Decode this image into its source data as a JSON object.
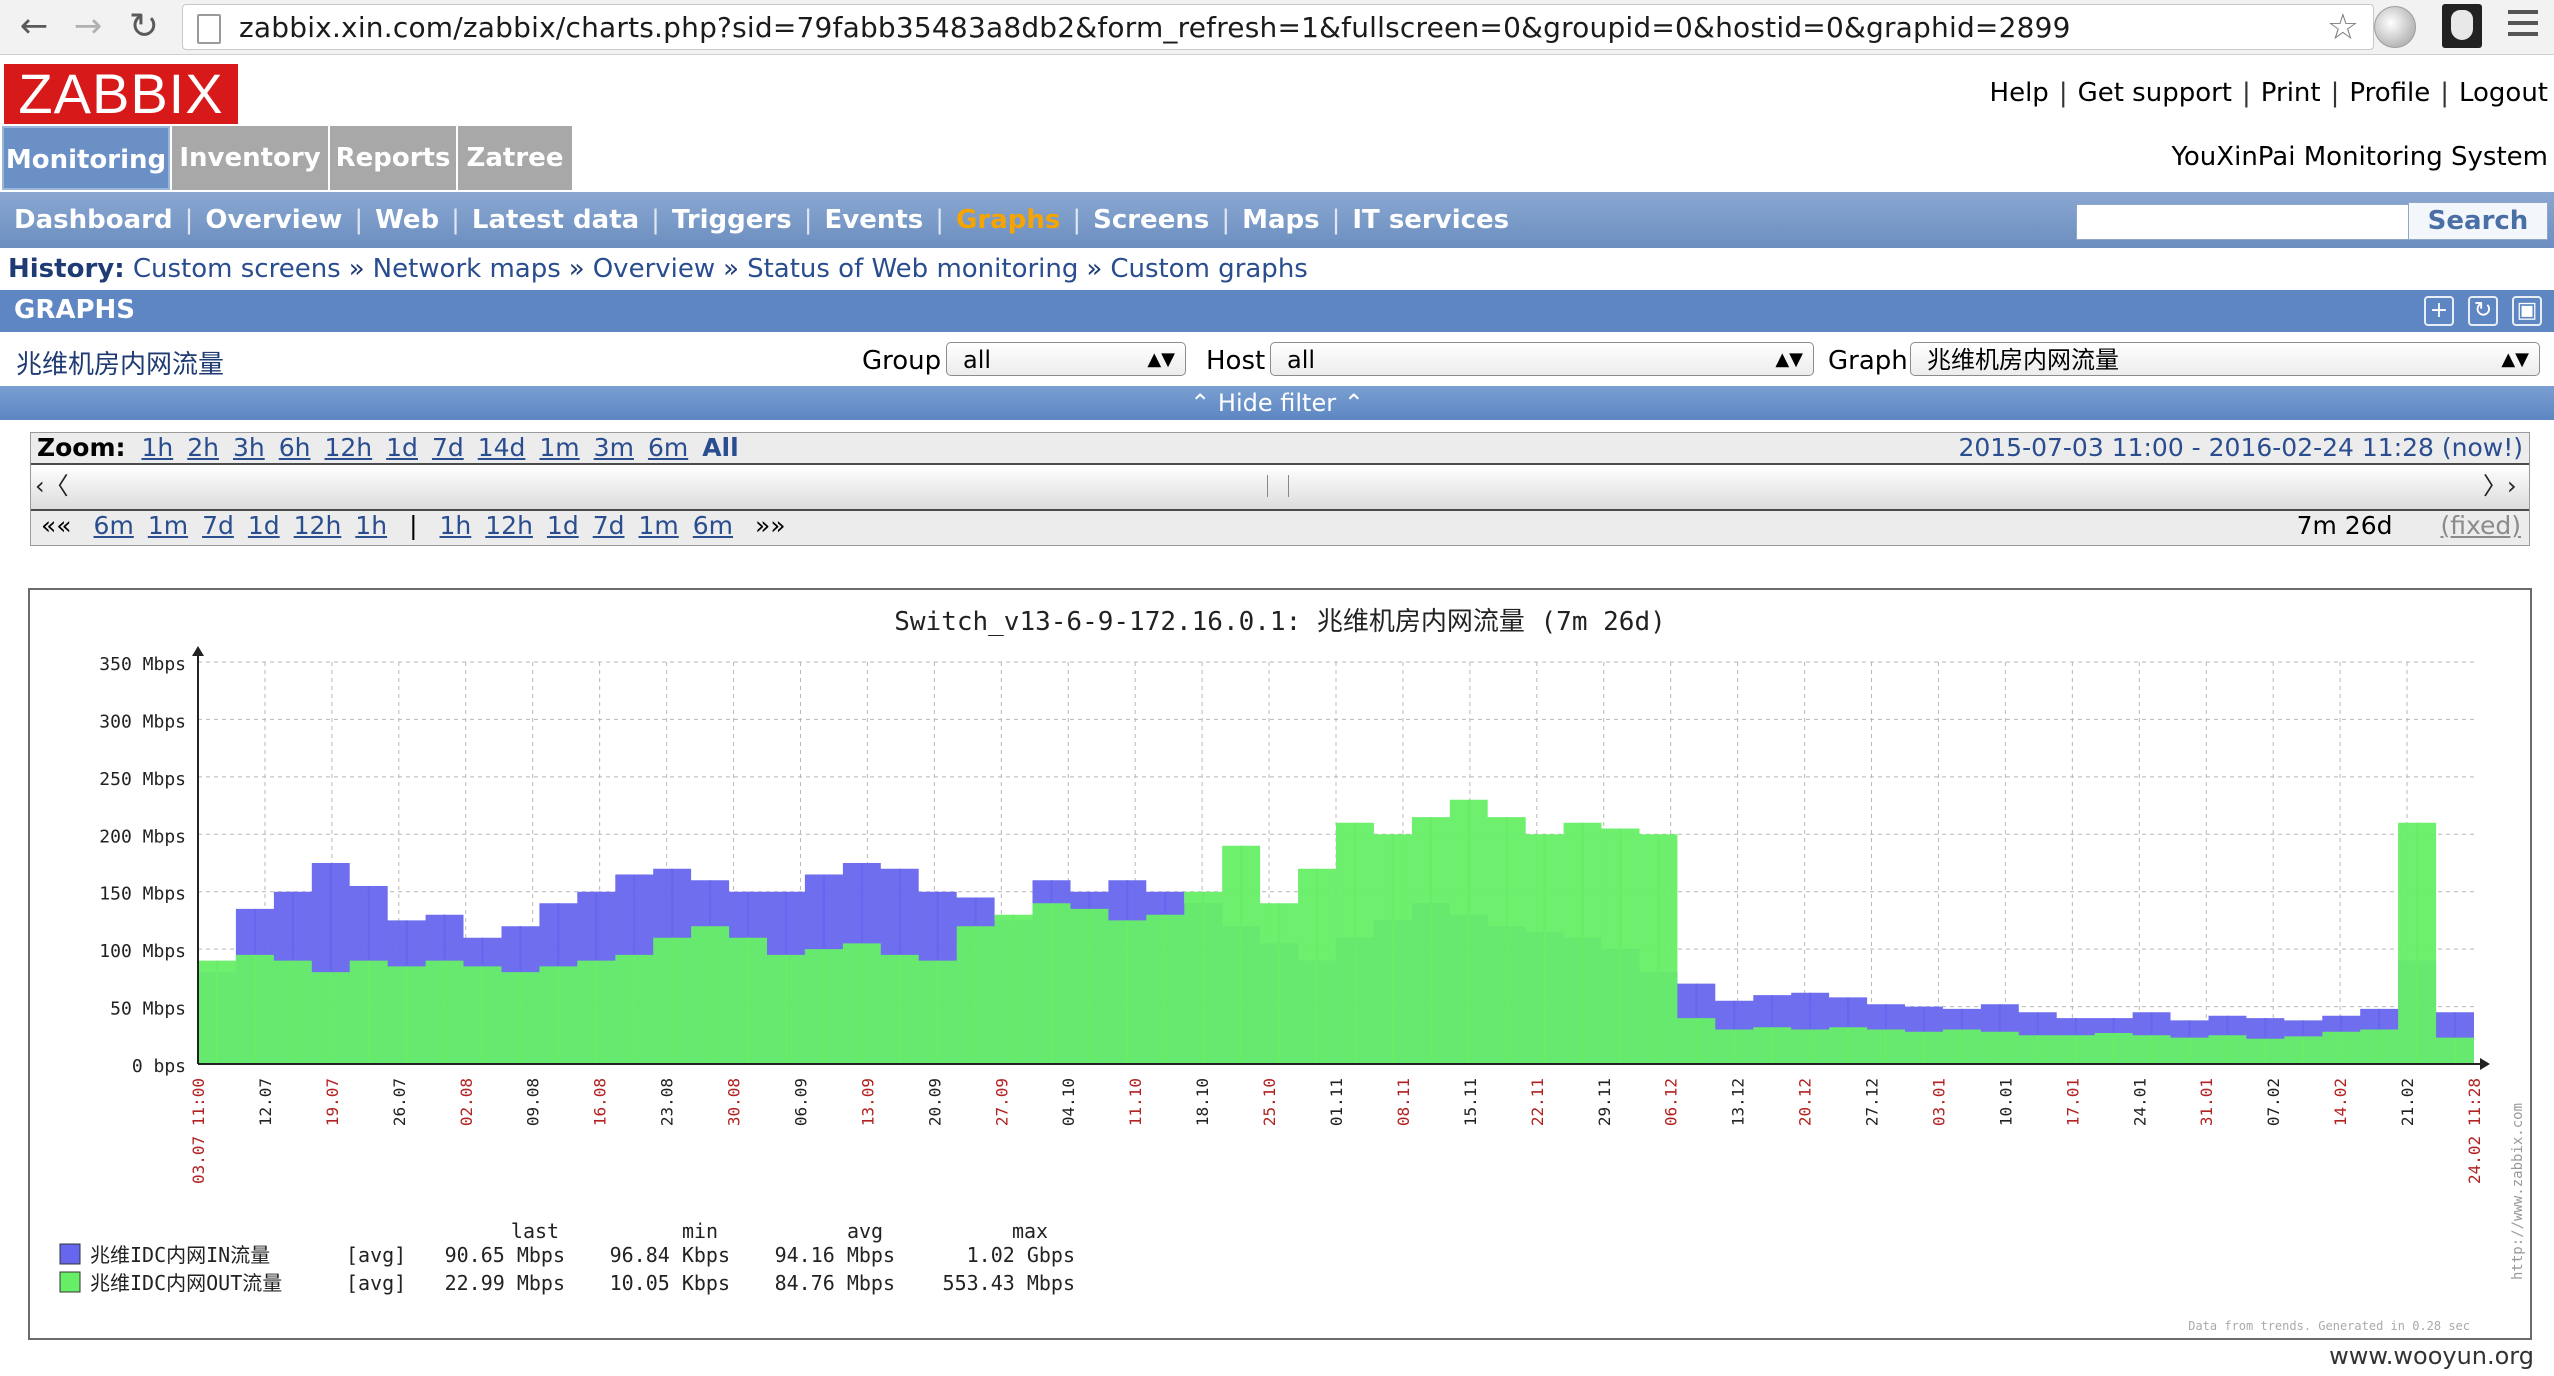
{
  "browser": {
    "url": "zabbix.xin.com/zabbix/charts.php?sid=79fabb35483a8db2&form_refresh=1&fullscreen=0&groupid=0&hostid=0&graphid=2899",
    "icons": [
      "back-arrow-icon",
      "forward-arrow-icon",
      "reload-icon",
      "page-icon",
      "star-icon",
      "extension-icon",
      "user-mask-icon",
      "menu-icon"
    ]
  },
  "header": {
    "logo": "ZABBIX",
    "links": [
      "Help",
      "Get support",
      "Print",
      "Profile",
      "Logout"
    ],
    "system_name": "YouXinPai Monitoring System"
  },
  "main_menu": [
    "Monitoring",
    "Inventory",
    "Reports",
    "Zatree"
  ],
  "sub_menu": [
    "Dashboard",
    "Overview",
    "Web",
    "Latest data",
    "Triggers",
    "Events",
    "Graphs",
    "Screens",
    "Maps",
    "IT services"
  ],
  "sub_menu_active": "Graphs",
  "search": {
    "value": "",
    "button": "Search"
  },
  "history": {
    "label": "History:",
    "items": [
      "Custom screens",
      "Network maps",
      "Overview",
      "Status of Web monitoring",
      "Custom graphs"
    ],
    "separator": "»"
  },
  "graphs_section": {
    "title": "GRAPHS"
  },
  "filter": {
    "graph_name": "兆维机房内网流量",
    "group_label": "Group",
    "group_value": "all",
    "host_label": "Host",
    "host_value": "all",
    "graph_label": "Graph",
    "graph_value": "兆维机房内网流量",
    "hide_filter": "Hide filter"
  },
  "zoom": {
    "label": "Zoom:",
    "options": [
      "1h",
      "2h",
      "3h",
      "6h",
      "12h",
      "1d",
      "7d",
      "14d",
      "1m",
      "3m",
      "6m"
    ],
    "all": "All",
    "period": "2015-07-03 11:00  -  2016-02-24 11:28 (now!)",
    "back": [
      "6m",
      "1m",
      "7d",
      "1d",
      "12h",
      "1h"
    ],
    "fwd": [
      "1h",
      "12h",
      "1d",
      "7d",
      "1m",
      "6m"
    ],
    "back_glyph": "««",
    "fwd_glyph": "»»",
    "pipe": "|",
    "duration": "7m 26d",
    "fixed": "(fixed)"
  },
  "chart_data": {
    "type": "area",
    "title": "Switch_v13-6-9-172.16.0.1: 兆维机房内网流量 (7m 26d)",
    "y_unit": "Mbps",
    "yticks": [
      "0 bps",
      "50 Mbps",
      "100 Mbps",
      "150 Mbps",
      "200 Mbps",
      "250 Mbps",
      "300 Mbps",
      "350 Mbps"
    ],
    "ylim": [
      0,
      350
    ],
    "x_labels": [
      "03.07 11:00",
      "12.07",
      "19.07",
      "26.07",
      "02.08",
      "09.08",
      "16.08",
      "23.08",
      "30.08",
      "06.09",
      "13.09",
      "20.09",
      "27.09",
      "04.10",
      "11.10",
      "18.10",
      "25.10",
      "01.11",
      "08.11",
      "15.11",
      "22.11",
      "29.11",
      "06.12",
      "13.12",
      "20.12",
      "27.12",
      "03.01",
      "10.01",
      "17.01",
      "24.01",
      "31.01",
      "07.02",
      "14.02",
      "21.02",
      "24.02 11:28"
    ],
    "x_label_red": [
      "03.07 11:00",
      "19.07",
      "02.08",
      "16.08",
      "30.08",
      "13.09",
      "27.09",
      "11.10",
      "25.10",
      "08.11",
      "22.11",
      "06.12",
      "20.12",
      "03.01",
      "17.01",
      "31.01",
      "14.02",
      "24.02 11:28"
    ],
    "series": [
      {
        "name": "兆维IDC内网IN流量",
        "color": "#6666ee",
        "values": [
          80,
          135,
          150,
          175,
          155,
          125,
          130,
          110,
          120,
          140,
          150,
          165,
          170,
          160,
          150,
          150,
          165,
          175,
          170,
          150,
          145,
          125,
          160,
          150,
          160,
          150,
          140,
          120,
          105,
          90,
          110,
          125,
          140,
          130,
          120,
          115,
          110,
          100,
          80,
          70,
          55,
          60,
          62,
          58,
          52,
          50,
          48,
          52,
          45,
          40,
          40,
          45,
          38,
          42,
          40,
          38,
          42,
          48,
          90,
          45
        ],
        "stats": {
          "function": "[avg]",
          "last": "90.65 Mbps",
          "min": "96.84 Kbps",
          "avg": "94.16 Mbps",
          "max": "1.02 Gbps"
        }
      },
      {
        "name": "兆维IDC内网OUT流量",
        "color": "#66ee66",
        "values": [
          90,
          95,
          90,
          80,
          90,
          85,
          90,
          85,
          80,
          85,
          90,
          95,
          110,
          120,
          110,
          95,
          100,
          105,
          95,
          90,
          120,
          130,
          140,
          135,
          125,
          130,
          150,
          190,
          140,
          170,
          210,
          200,
          215,
          230,
          215,
          200,
          210,
          205,
          200,
          40,
          30,
          32,
          30,
          32,
          30,
          28,
          30,
          28,
          25,
          25,
          27,
          25,
          23,
          25,
          22,
          24,
          28,
          30,
          210,
          23
        ],
        "stats": {
          "function": "[avg]",
          "last": "22.99 Mbps",
          "min": "10.05 Kbps",
          "avg": "84.76 Mbps",
          "max": "553.43 Mbps"
        }
      }
    ],
    "legend_headers": [
      "last",
      "min",
      "avg",
      "max"
    ],
    "side_caption": "http://www.zabbix.com",
    "footer_note": "Data from trends. Generated in 0.28 sec"
  },
  "watermark": "www.wooyun.org"
}
